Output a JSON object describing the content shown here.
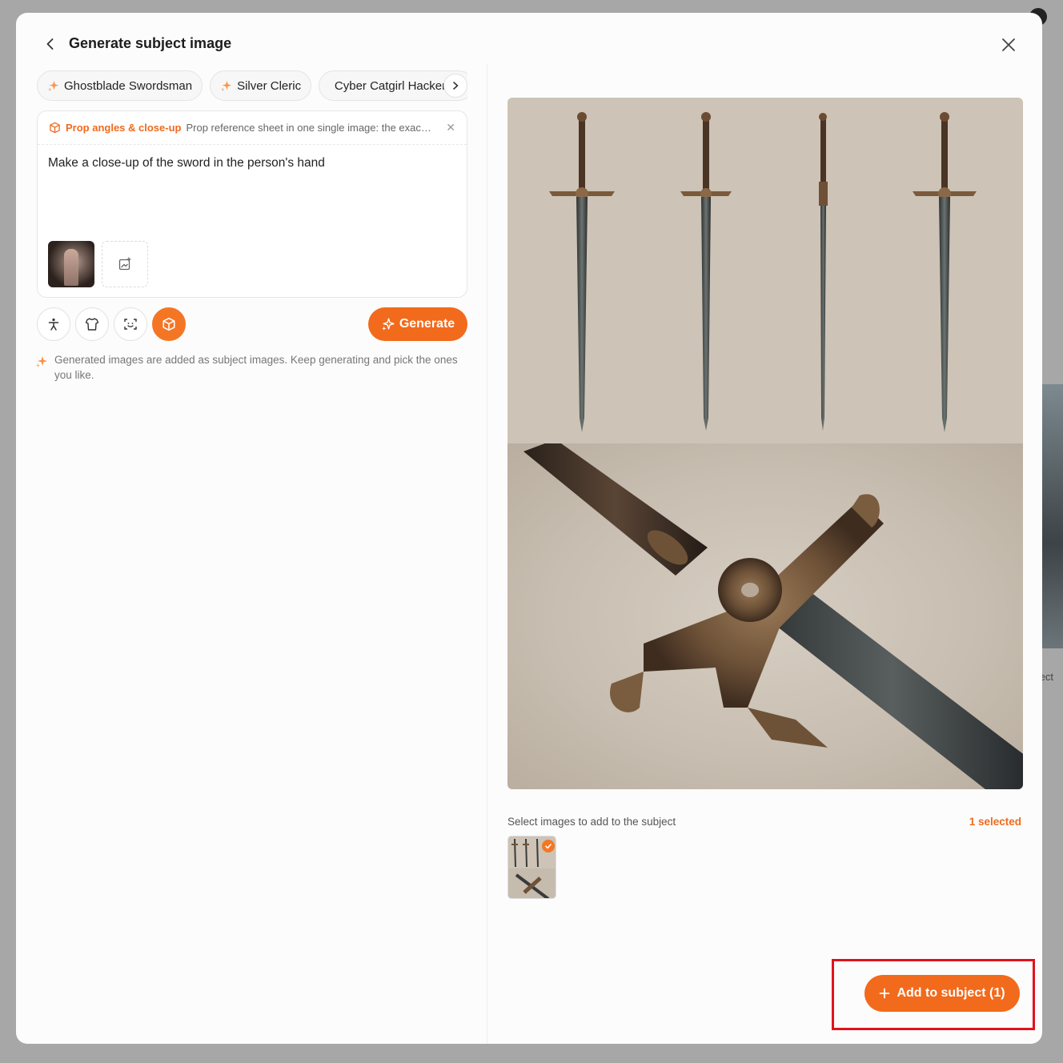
{
  "header": {
    "title": "Generate subject image"
  },
  "chips": [
    {
      "label": "Ghostblade Swordsman"
    },
    {
      "label": "Silver Cleric"
    },
    {
      "label": "Cyber Catgirl Hacker"
    }
  ],
  "template": {
    "name": "Prop angles & close-up",
    "description": "Prop reference sheet in one single image: the exact s···"
  },
  "prompt": {
    "text": "Make a close-up of the sword in the person's hand"
  },
  "tools": [
    "pose-icon",
    "outfit-icon",
    "face-scan-icon",
    "prop-box-icon"
  ],
  "generate_label": "Generate",
  "hint": "Generated images are added as subject images. Keep generating and pick the ones you like.",
  "selection": {
    "label": "Select images to add to the subject",
    "count_label": "1 selected"
  },
  "add_button": {
    "label": "Add to subject (1)"
  },
  "background": {
    "partial_text": "ect"
  },
  "colors": {
    "accent": "#f26a1b",
    "highlight": "#e0131b"
  }
}
